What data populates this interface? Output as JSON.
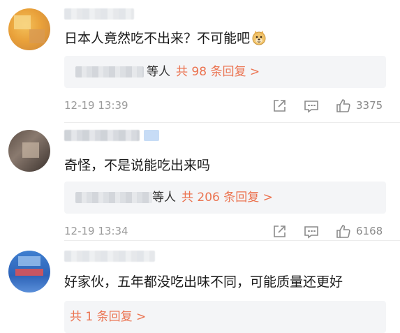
{
  "comments": [
    {
      "text": "日本人竟然吃不出来？不可能吧",
      "reply_suffix": "等人",
      "reply_count": "共 98 条回复 >",
      "time": "12-19 13:39",
      "likes": "3375"
    },
    {
      "text": "奇怪，不是说能吃出来吗",
      "reply_suffix": "等人",
      "reply_count": "共 206 条回复 >",
      "time": "12-19 13:34",
      "likes": "6168"
    },
    {
      "text": "好家伙，五年都没吃出味不同，可能质量还更好",
      "reply_count": "共 1 条回复 >"
    }
  ],
  "colors": {
    "accent": "#eb7350",
    "meta": "#9a9a9a",
    "reply_bg": "#f4f5f7"
  }
}
